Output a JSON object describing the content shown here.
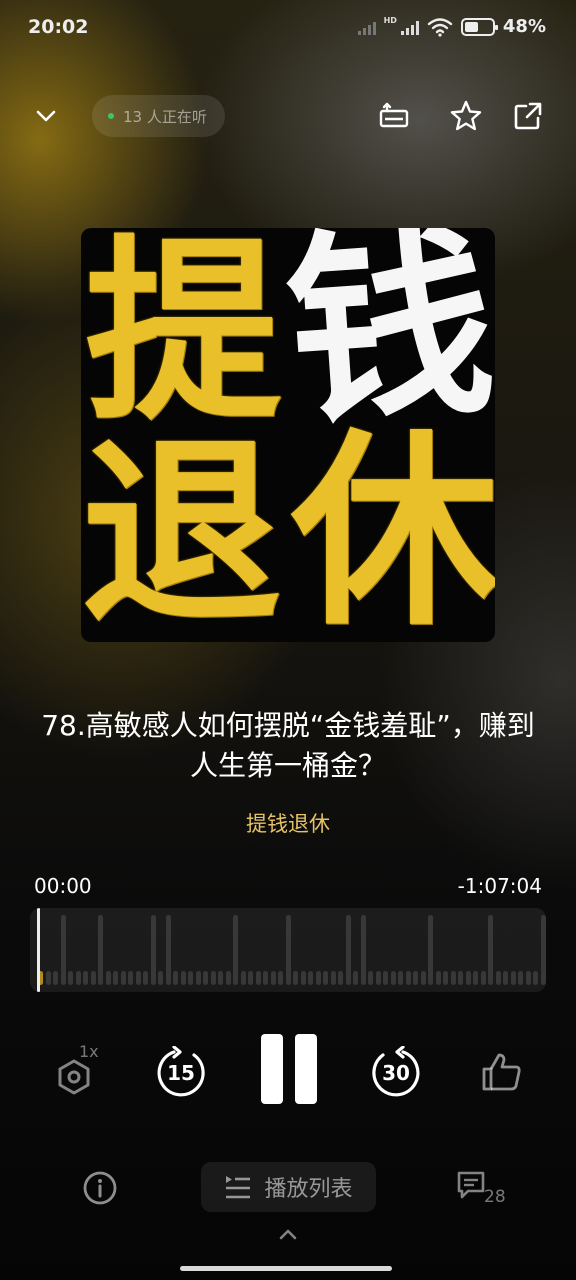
{
  "status_bar": {
    "time": "20:02",
    "network_label": "HD",
    "battery_pct": "48%",
    "battery_level": 0.48
  },
  "top_bar": {
    "listeners_text": "13 人正在听",
    "icons": [
      "chevron-down-icon",
      "cast-icon",
      "star-icon",
      "share-icon"
    ]
  },
  "cover": {
    "chars": [
      "提",
      "钱",
      "退",
      "休"
    ],
    "colors": {
      "gold": "#e9bf2a",
      "white": "#f6f6f6",
      "background": "#050505"
    }
  },
  "episode": {
    "title": "78.高敏感人如何摆脱“金钱羞耻”，赚到人生第一桶金？",
    "podcast": "提钱退休"
  },
  "progress": {
    "current": "00:00",
    "remaining": "-1:07:04",
    "fraction": 0.0
  },
  "controls": {
    "speed": "1x",
    "rewind_seconds": "15",
    "forward_seconds": "30",
    "state": "playing"
  },
  "bottom_bar": {
    "playlist_label": "播放列表",
    "comments_count": "28"
  },
  "colors": {
    "accent": "#e5c268",
    "listeners_dot": "#3fc46a",
    "waveform_played": "#b18c1c"
  }
}
